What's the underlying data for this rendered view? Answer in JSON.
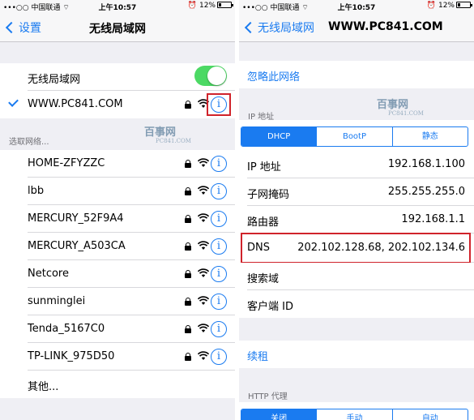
{
  "status": {
    "carrier": "中国联通",
    "time": "上午10:57",
    "battery": "12%"
  },
  "left": {
    "nav": {
      "back_label": "设置",
      "title": "无线局域网"
    },
    "wifi_toggle": {
      "label": "无线局域网",
      "on": true
    },
    "connected": {
      "name": "WWW.PC841.COM",
      "secured": true
    },
    "section_header": "选取网络...",
    "networks": [
      {
        "name": "HOME-ZFYZZC"
      },
      {
        "name": "lbb"
      },
      {
        "name": "MERCURY_52F9A4"
      },
      {
        "name": "MERCURY_A503CA"
      },
      {
        "name": "Netcore"
      },
      {
        "name": "sunminglei"
      },
      {
        "name": "Tenda_5167C0"
      },
      {
        "name": "TP-LINK_975D50"
      }
    ],
    "other_label": "其他...",
    "watermark": {
      "brand": "百事网",
      "site": "PC841.COM"
    }
  },
  "right": {
    "nav": {
      "back_label": "无线局域网",
      "title": "WWW.PC841.COM"
    },
    "forget_label": "忽略此网络",
    "ip_section_header": "IP 地址",
    "ip_modes": [
      "DHCP",
      "BootP",
      "静态"
    ],
    "ip_mode_selected": "DHCP",
    "fields": [
      {
        "label": "IP 地址",
        "value": "192.168.1.100"
      },
      {
        "label": "子网掩码",
        "value": "255.255.255.0"
      },
      {
        "label": "路由器",
        "value": "192.168.1.1"
      },
      {
        "label": "DNS",
        "value": "202.102.128.68, 202.102.134.6"
      },
      {
        "label": "搜索域",
        "value": ""
      },
      {
        "label": "客户端 ID",
        "value": ""
      }
    ],
    "renew_label": "续租",
    "http_proxy_header": "HTTP 代理",
    "proxy_modes": [
      "关闭",
      "手动",
      "自动"
    ],
    "proxy_mode_selected": "关闭",
    "watermark": {
      "brand": "百事网",
      "site": "PC841.COM"
    }
  },
  "colors": {
    "accent": "#1a7bf0",
    "toggle_on": "#4cd964",
    "highlight": "#d0232b",
    "grouped_bg": "#efeff4"
  }
}
